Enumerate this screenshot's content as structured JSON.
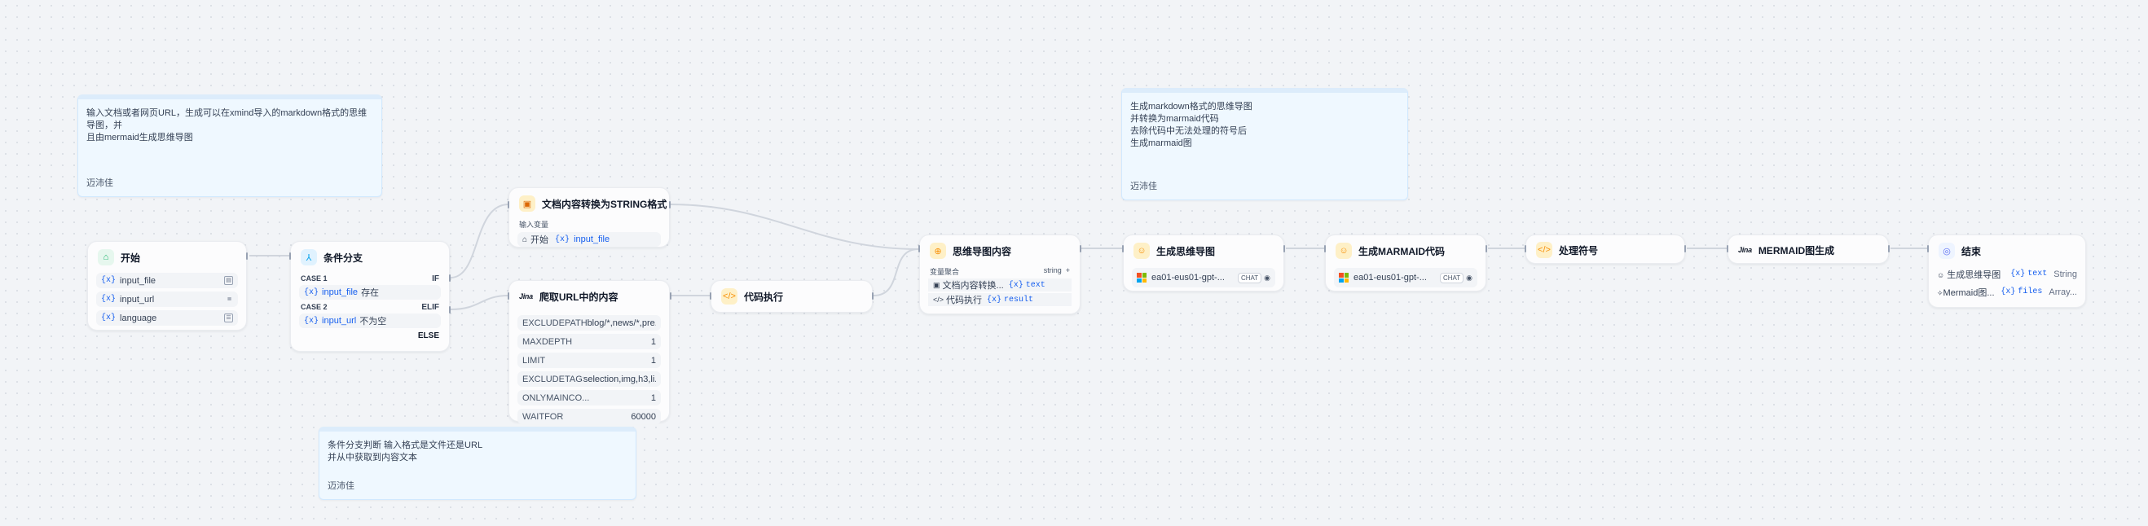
{
  "notes": [
    {
      "text": "输入文档或者网页URL，生成可以在xmind导入的markdown格式的思维导图，并\n且由mermaid生成思维导图",
      "author": "迈沛佳"
    },
    {
      "text": "生成markdown格式的思维导图\n并转换为marmaid代码\n去除代码中无法处理的符号后\n生成marmaid图",
      "author": "迈沛佳"
    },
    {
      "text": "条件分支判断 输入格式是文件还是URL\n并从中获取到内容文本",
      "author": "迈沛佳"
    }
  ],
  "start": {
    "title": "开始",
    "vars": [
      {
        "sym": "{x}",
        "name": "input_file",
        "type_icon": "file"
      },
      {
        "sym": "{x}",
        "name": "input_url",
        "type_icon": "text"
      },
      {
        "sym": "{x}",
        "name": "language",
        "type_icon": "select"
      }
    ]
  },
  "ifelse": {
    "title": "条件分支",
    "case1": {
      "label": "CASE 1",
      "tag": "IF",
      "sym": "{x}",
      "var": "input_file",
      "op": "存在"
    },
    "case2": {
      "label": "CASE 2",
      "tag": "ELIF",
      "sym": "{x}",
      "var": "input_url",
      "op": "不为空"
    },
    "else": "ELSE"
  },
  "docextract": {
    "title": "文档内容转换为STRING格式",
    "input_label": "输入变量",
    "input": {
      "src": "开始",
      "sym": "{x}",
      "var": "input_file"
    }
  },
  "jina": {
    "title": "爬取URL中的内容",
    "logo": "Jina",
    "params": [
      {
        "k": "EXCLUDEPATHS",
        "v": "blog/*,news/*,pre..."
      },
      {
        "k": "MAXDEPTH",
        "v": "1"
      },
      {
        "k": "LIMIT",
        "v": "1"
      },
      {
        "k": "EXCLUDETAGS",
        "v": "selection,img,h3,li..."
      },
      {
        "k": "ONLYMAINCO...",
        "v": "1"
      },
      {
        "k": "WAITFOR",
        "v": "60000"
      }
    ]
  },
  "code": {
    "title": "代码执行"
  },
  "aggregator": {
    "title": "思维导图内容",
    "label": "变量聚合",
    "type": "string",
    "rows": [
      {
        "src": "文档内容转换...",
        "sym": "{x}",
        "var": "text"
      },
      {
        "src": "代码执行",
        "sym": "{x}",
        "var": "result"
      }
    ]
  },
  "llm1": {
    "title": "生成思维导图",
    "model": "ea01-eus01-gpt-...",
    "chip": "CHAT"
  },
  "llm2": {
    "title": "生成MARMAID代码",
    "model": "ea01-eus01-gpt-...",
    "chip": "CHAT"
  },
  "clean": {
    "title": "处理符号"
  },
  "mermaid": {
    "title": "MERMAID图生成",
    "logo": "Jina"
  },
  "end": {
    "title": "结束",
    "rows": [
      {
        "src": "生成思维导图",
        "sym": "{x}",
        "var": "text",
        "type": "String"
      },
      {
        "src": "Mermaid图...",
        "sym": "{x}",
        "var": "files",
        "type": "Array..."
      }
    ]
  },
  "colors": {
    "accent": "#155eef",
    "edge": "#d0d5dd",
    "note_bg": "#eff8ff",
    "code_icon": "#f79009",
    "llm_icon": "#f79009",
    "start_icon": "#17b26a",
    "end_icon": "#6172f3"
  }
}
